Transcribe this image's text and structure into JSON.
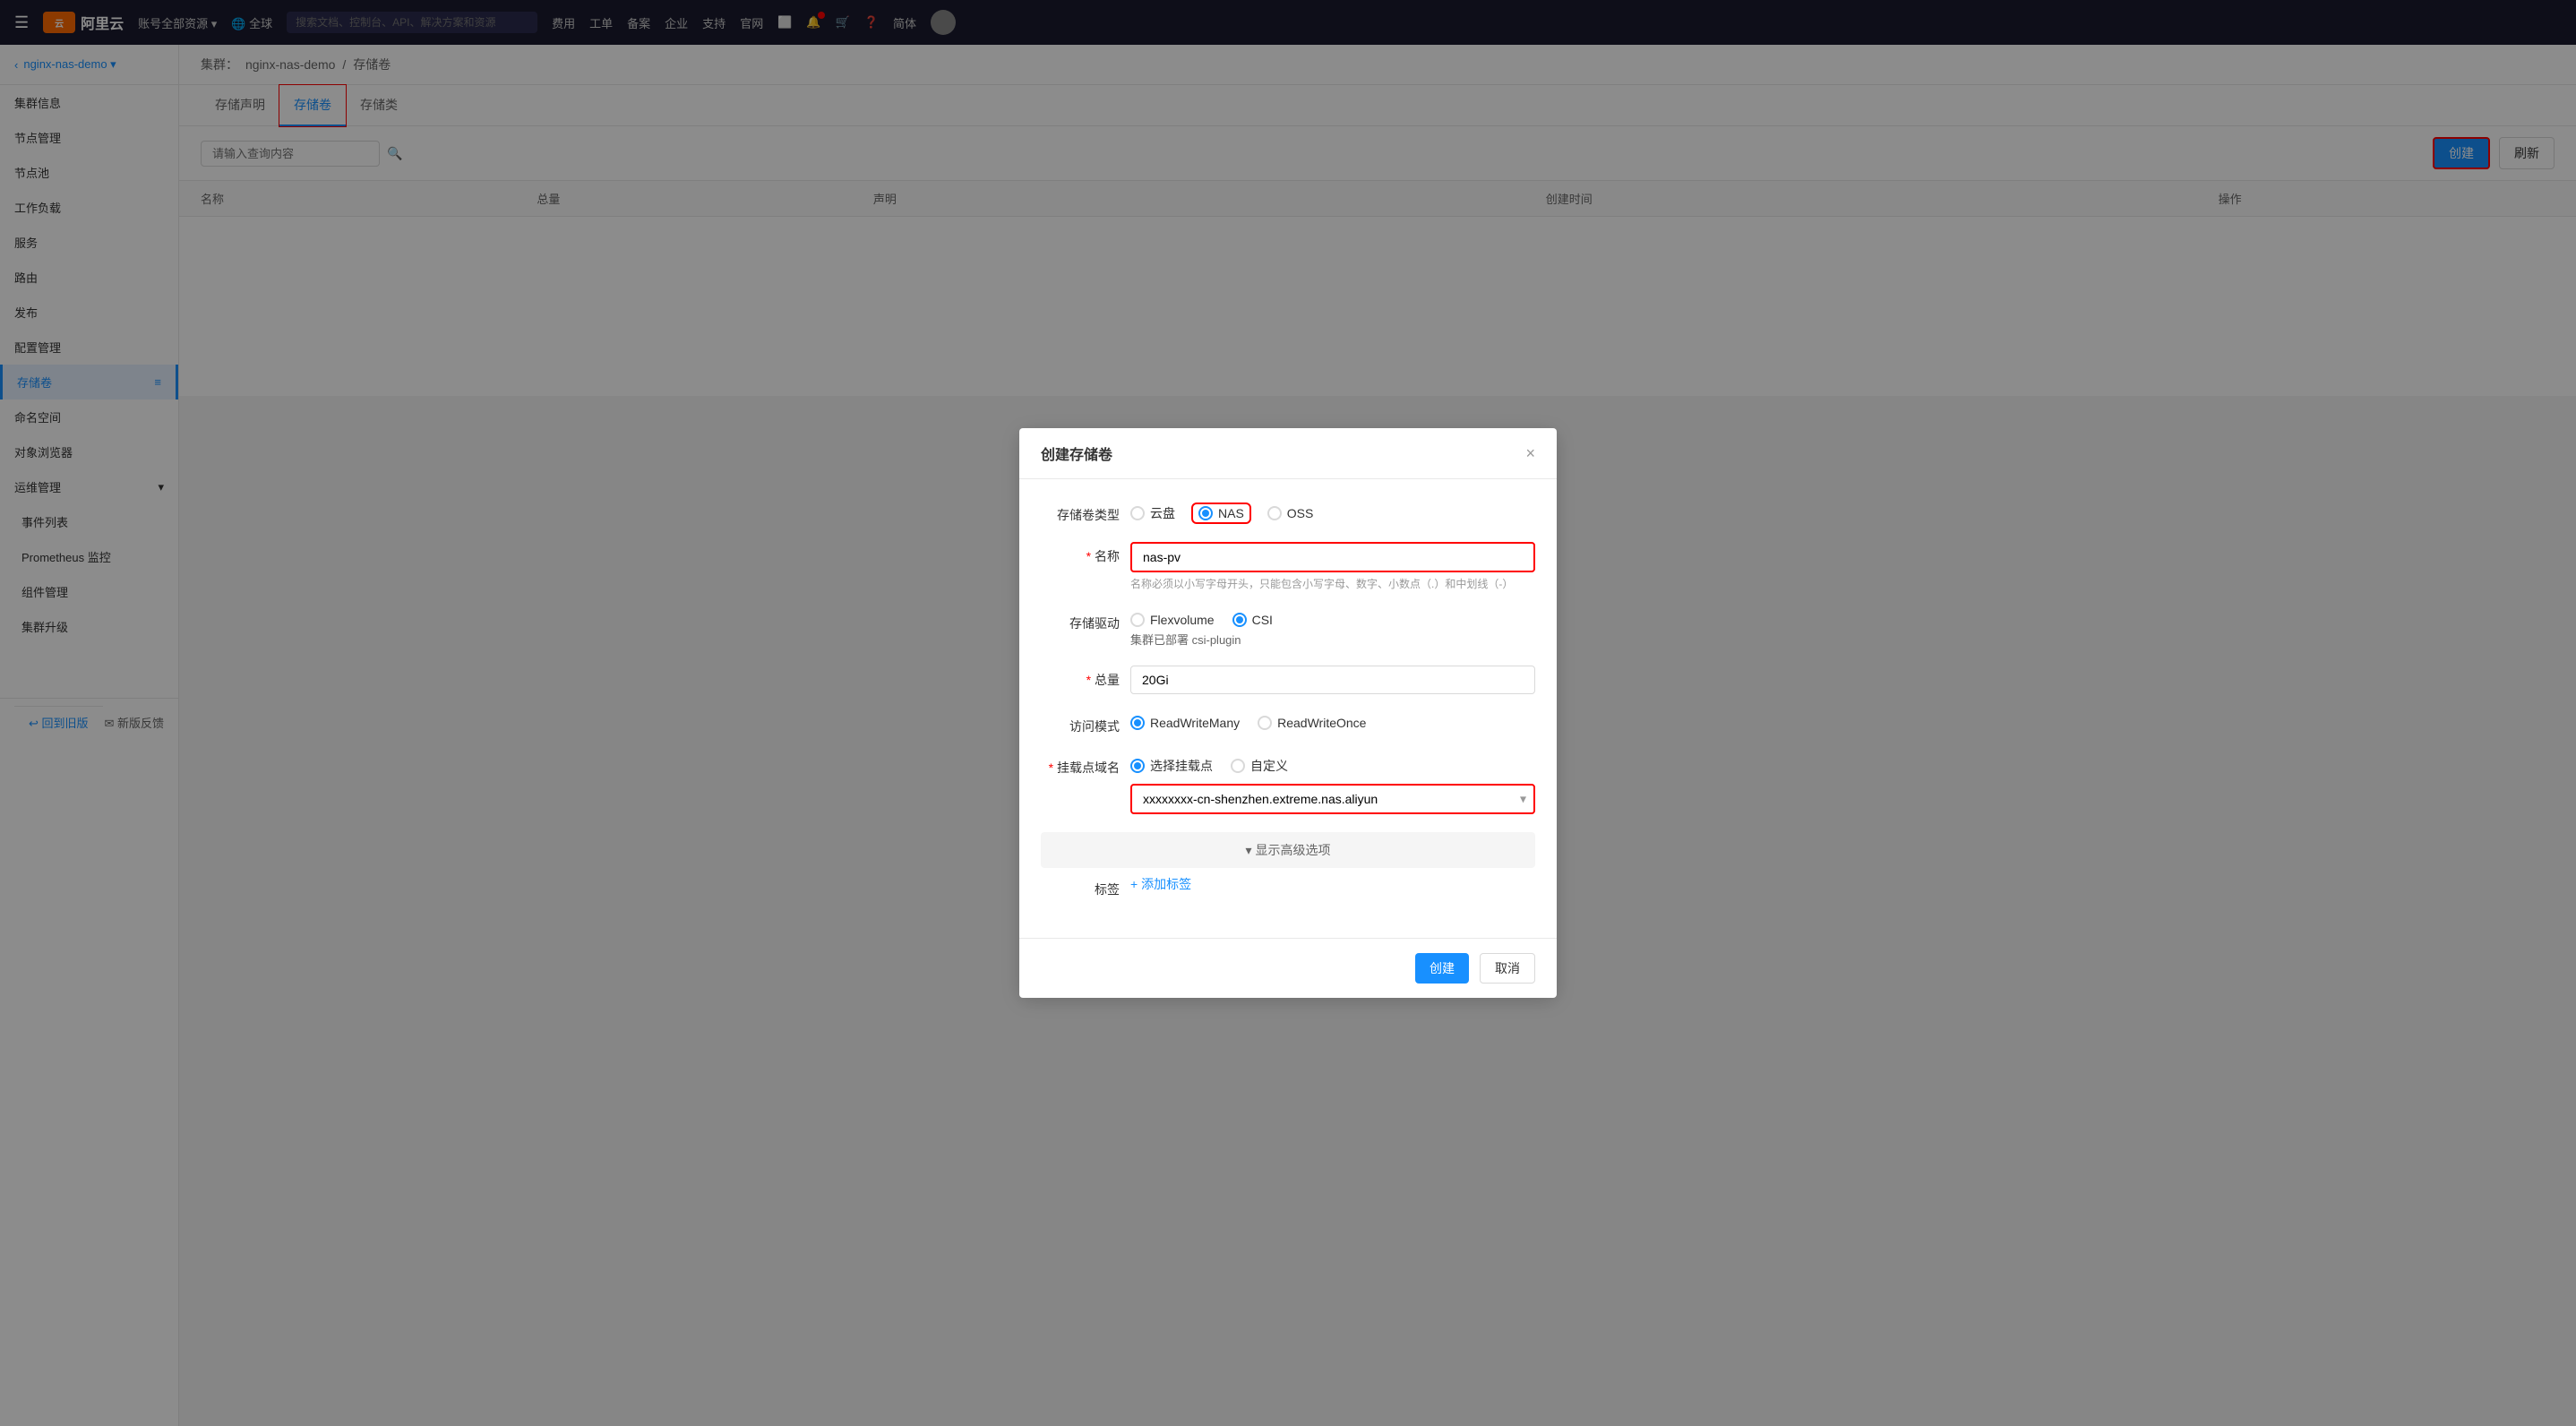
{
  "topnav": {
    "menu_icon": "☰",
    "logo_text": "阿里云",
    "account_label": "账号全部资源 ▾",
    "global_label": "🌐 全球",
    "search_placeholder": "搜索文档、控制台、API、解决方案和资源",
    "nav_items": [
      "费用",
      "工单",
      "备案",
      "企业",
      "支持",
      "官网"
    ],
    "lang": "简体"
  },
  "sidebar": {
    "back_label": "nginx-nas-demo ▾",
    "items": [
      {
        "label": "集群信息",
        "active": false
      },
      {
        "label": "节点管理",
        "active": false
      },
      {
        "label": "节点池",
        "active": false
      },
      {
        "label": "工作负载",
        "active": false
      },
      {
        "label": "服务",
        "active": false
      },
      {
        "label": "路由",
        "active": false
      },
      {
        "label": "发布",
        "active": false
      },
      {
        "label": "配置管理",
        "active": false
      },
      {
        "label": "存储卷",
        "active": true
      },
      {
        "label": "命名空间",
        "active": false
      },
      {
        "label": "对象浏览器",
        "active": false
      },
      {
        "label": "运维管理",
        "active": false,
        "expanded": true
      },
      {
        "label": "事件列表",
        "sub": true,
        "active": false
      },
      {
        "label": "Prometheus 监控",
        "sub": true,
        "active": false
      },
      {
        "label": "组件管理",
        "sub": true,
        "active": false
      },
      {
        "label": "集群升级",
        "sub": true,
        "active": false
      }
    ],
    "return_label": "↩ 回到旧版",
    "feedback_label": "✉ 新版反馈"
  },
  "main": {
    "breadcrumb_cluster": "集群：",
    "breadcrumb_name": "nginx-nas-demo",
    "breadcrumb_section": "存储卷",
    "tabs": [
      {
        "label": "存储声明",
        "active": false
      },
      {
        "label": "存储卷",
        "active": true
      },
      {
        "label": "存储类",
        "active": false
      }
    ],
    "search_placeholder": "请输入查询内容",
    "create_btn": "创建",
    "refresh_btn": "刷新",
    "table_cols": [
      "名称",
      "总量",
      "声明",
      "创建时间",
      "操作"
    ]
  },
  "modal": {
    "title": "创建存储卷",
    "close_icon": "×",
    "storage_type_label": "存储卷类型",
    "storage_types": [
      {
        "label": "云盘",
        "selected": false
      },
      {
        "label": "NAS",
        "selected": true
      },
      {
        "label": "OSS",
        "selected": false
      }
    ],
    "name_label": "名称",
    "name_value": "nas-pv",
    "name_hint": "名称必须以小写字母开头，只能包含小写字母、数字、小数点（.）和中划线（-）",
    "driver_label": "存储驱动",
    "drivers": [
      {
        "label": "Flexvolume",
        "selected": false
      },
      {
        "label": "CSI",
        "selected": true
      }
    ],
    "cluster_note": "集群已部署 csi-plugin",
    "capacity_label": "总量",
    "capacity_value": "20Gi",
    "access_mode_label": "访问模式",
    "access_modes": [
      {
        "label": "ReadWriteMany",
        "selected": true
      },
      {
        "label": "ReadWriteOnce",
        "selected": false
      }
    ],
    "mount_label": "挂载点域名",
    "mount_options": [
      {
        "label": "选择挂载点",
        "selected": true
      },
      {
        "label": "自定义",
        "selected": false
      }
    ],
    "mount_value": "xxxxxxxx-cn-shenzhen.extreme.nas.aliyun",
    "advanced_label": "▾ 显示高级选项",
    "tag_label": "标签",
    "add_tag_label": "+ 添加标签",
    "create_btn": "创建",
    "cancel_btn": "取消"
  }
}
